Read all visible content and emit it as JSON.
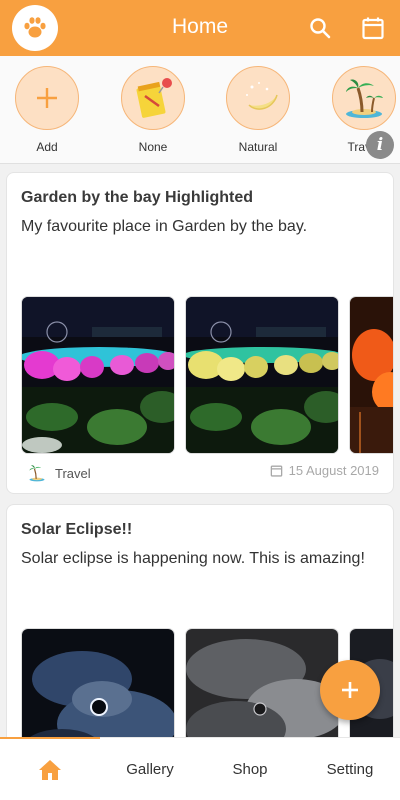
{
  "app": {
    "title": "Home"
  },
  "header": {
    "logo_icon": "paw-icon",
    "search_icon": "search-icon",
    "calendar_icon": "calendar-icon"
  },
  "categories": [
    {
      "label": "Add",
      "icon": "plus-icon"
    },
    {
      "label": "None",
      "icon": "notepad-icon"
    },
    {
      "label": "Natural",
      "icon": "moon-stars-icon"
    },
    {
      "label": "Travel",
      "icon": "palm-island-icon"
    }
  ],
  "info_button": "i",
  "posts": [
    {
      "title": "Garden by the bay Highlighted",
      "body": "My favourite place in Garden by the bay.",
      "category": "Travel",
      "date": "15 August 2019"
    },
    {
      "title": "Solar Eclipse!!",
      "body": "Solar eclipse is happening now. This is amazing!"
    }
  ],
  "fab_icon": "plus-icon",
  "nav": {
    "home_icon": "home-icon",
    "gallery": "Gallery",
    "shop": "Shop",
    "setting": "Setting"
  },
  "colors": {
    "accent": "#f8a040",
    "category_bg": "#fde0c4"
  }
}
